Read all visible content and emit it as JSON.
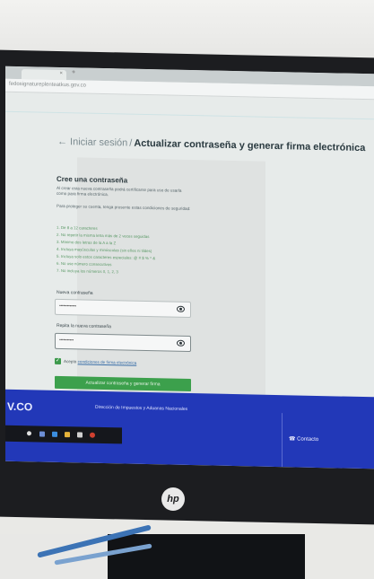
{
  "browser": {
    "tab_close": "×",
    "tab_new": "+",
    "url": "fedosignatureplenteatkus.gov.co"
  },
  "page": {
    "back_link": "← Iniciar sesión",
    "separator": "/",
    "heading": "Actualizar contraseña y generar firma electrónica"
  },
  "form": {
    "title": "Cree una contraseña",
    "intro": "Al crear esta nueva contraseña podrá certificarse para uso de usarla como para firma electrónica.",
    "note": "Para proteger su cuenta, tenga presente estas condiciones de seguridad:",
    "requirements": [
      "1. De 8 a 12 caracteres",
      "2. No repetir la misma letra más de 2 veces seguidas",
      "3. Mínimo dos letras de la A a la Z",
      "4. Incluya mayúsculas y minúsculas (sin eñes ni tildes)",
      "5. Incluya solo estos caracteres especiales: @ # $ % ^ &",
      "6. No use número consecutivos",
      "7. No incluya los números 0, 1, 2, 3"
    ],
    "new_password_label": "Nueva contraseña",
    "new_password_value": "•••••••••••••",
    "repeat_password_label": "Repita la nueva contraseña",
    "repeat_password_value": "•••••••••••",
    "accept_prefix": "Acepto",
    "accept_link": "condiciones de firma electrónica",
    "submit_label": "Actualizar contraseña y generar firma"
  },
  "footer": {
    "logo_fragment": "V.CO",
    "org_name": "Dirección de Impuestos y Aduanas Nacionales",
    "contact_label": "Contacto",
    "contact_icon": "phone-icon"
  },
  "monitor": {
    "brand": "hp"
  }
}
